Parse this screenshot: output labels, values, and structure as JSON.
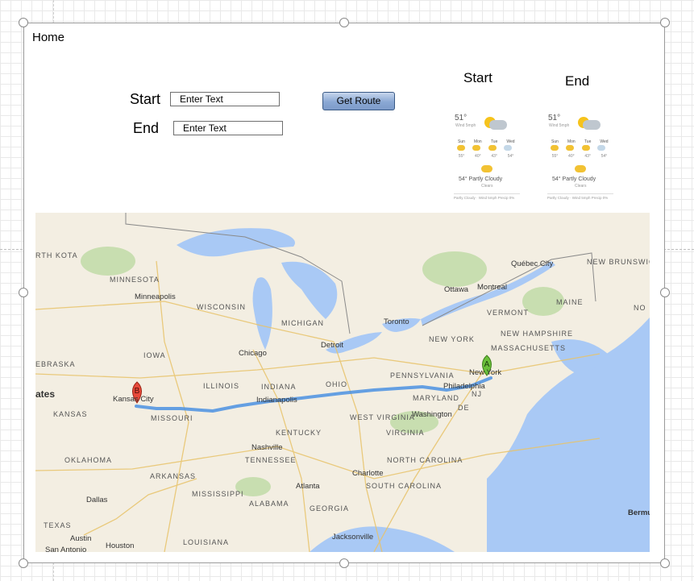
{
  "screen": {
    "title": "Home"
  },
  "form": {
    "start_label": "Start",
    "end_label": "End",
    "start_input_value": "Enter Text",
    "end_input_value": "Enter Text",
    "button_label": "Get Route"
  },
  "weather": {
    "start_label": "Start",
    "end_label": "End",
    "widget": {
      "temp": "51°",
      "wind": "Wind 5mph",
      "precip": "0%",
      "days": [
        "Sun",
        "Mon",
        "Tue",
        "Wed"
      ],
      "lows": [
        "55°",
        "40°",
        "43°",
        "54°"
      ],
      "summary": "54° Partly Cloudy",
      "subtext": "Clears",
      "footer": "Partly Cloudy · Wind 5mph Precip 0%"
    }
  },
  "map": {
    "marker_a": "A",
    "marker_b": "B",
    "regions": [
      "MINNESOTA",
      "WISCONSIN",
      "MICHIGAN",
      "IOWA",
      "ILLINOIS",
      "INDIANA",
      "OHIO",
      "PENNSYLVANIA",
      "NEW YORK",
      "VERMONT",
      "NEW HAMPSHIRE",
      "MASSACHUSETTS",
      "MAINE",
      "NEW BRUNSWICK",
      "KANSAS",
      "MISSOURI",
      "KENTUCKY",
      "WEST VIRGINIA",
      "VIRGINIA",
      "MARYLAND",
      "NJ",
      "DE",
      "TENNESSEE",
      "NORTH CAROLINA",
      "SOUTH CAROLINA",
      "OKLAHOMA",
      "ARKANSAS",
      "MISSISSIPPI",
      "ALABAMA",
      "GEORGIA",
      "LOUISIANA",
      "TEXAS",
      "EBRASKA",
      "RTH KOTA",
      "ates",
      "NO"
    ],
    "cities": [
      "Minneapolis",
      "Chicago",
      "Detroit",
      "Toronto",
      "Ottawa",
      "Montreal",
      "Québec City",
      "New York",
      "Philadelphia",
      "Washington",
      "Kansas City",
      "Indianapolis",
      "Nashville",
      "Atlanta",
      "Charlotte",
      "Dallas",
      "Austin",
      "San Antonio",
      "Houston",
      "Jacksonville",
      "Bermu"
    ],
    "colors": {
      "water": "#a9c9f5",
      "land": "#f3eee2",
      "park": "#c8deb0",
      "route": "#4a90e2",
      "marker_a": "#6abf3a",
      "marker_b": "#e8493a"
    }
  }
}
